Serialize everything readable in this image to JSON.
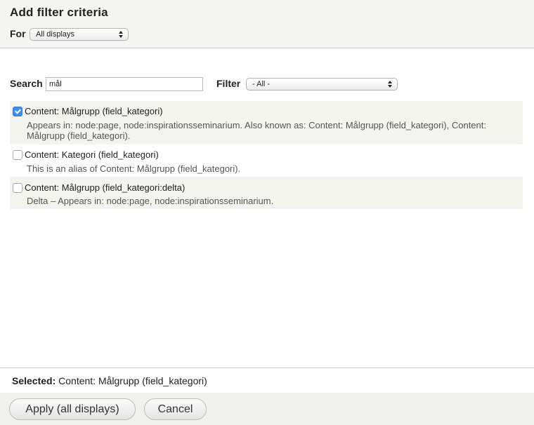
{
  "dialog": {
    "title": "Add filter criteria"
  },
  "for_field": {
    "label": "For",
    "selected": "All displays"
  },
  "search": {
    "label": "Search",
    "value": "mål"
  },
  "filter": {
    "label": "Filter",
    "selected": "- All -"
  },
  "results": [
    {
      "title": "Content: Målgrupp (field_kategori)",
      "checked": true,
      "description": "Appears in: node:page, node:inspirationsseminarium. Also known as: Content: Målgrupp (field_kategori), Content: Målgrupp (field_kategori)."
    },
    {
      "title": "Content: Kategori (field_kategori)",
      "checked": false,
      "description": "This is an alias of Content: Målgrupp (field_kategori)."
    },
    {
      "title": "Content: Målgrupp (field_kategori:delta)",
      "checked": false,
      "description": "Delta – Appears in: node:page, node:inspirationsseminarium."
    }
  ],
  "selected_summary": {
    "label": "Selected:",
    "value": "Content: Målgrupp (field_kategori)"
  },
  "buttons": {
    "apply": "Apply (all displays)",
    "cancel": "Cancel"
  },
  "colors": {
    "checkbox_checked": "#3b8cf4",
    "header_bg": "#f5f5f2",
    "row_stripe": "#f3f4ee"
  }
}
